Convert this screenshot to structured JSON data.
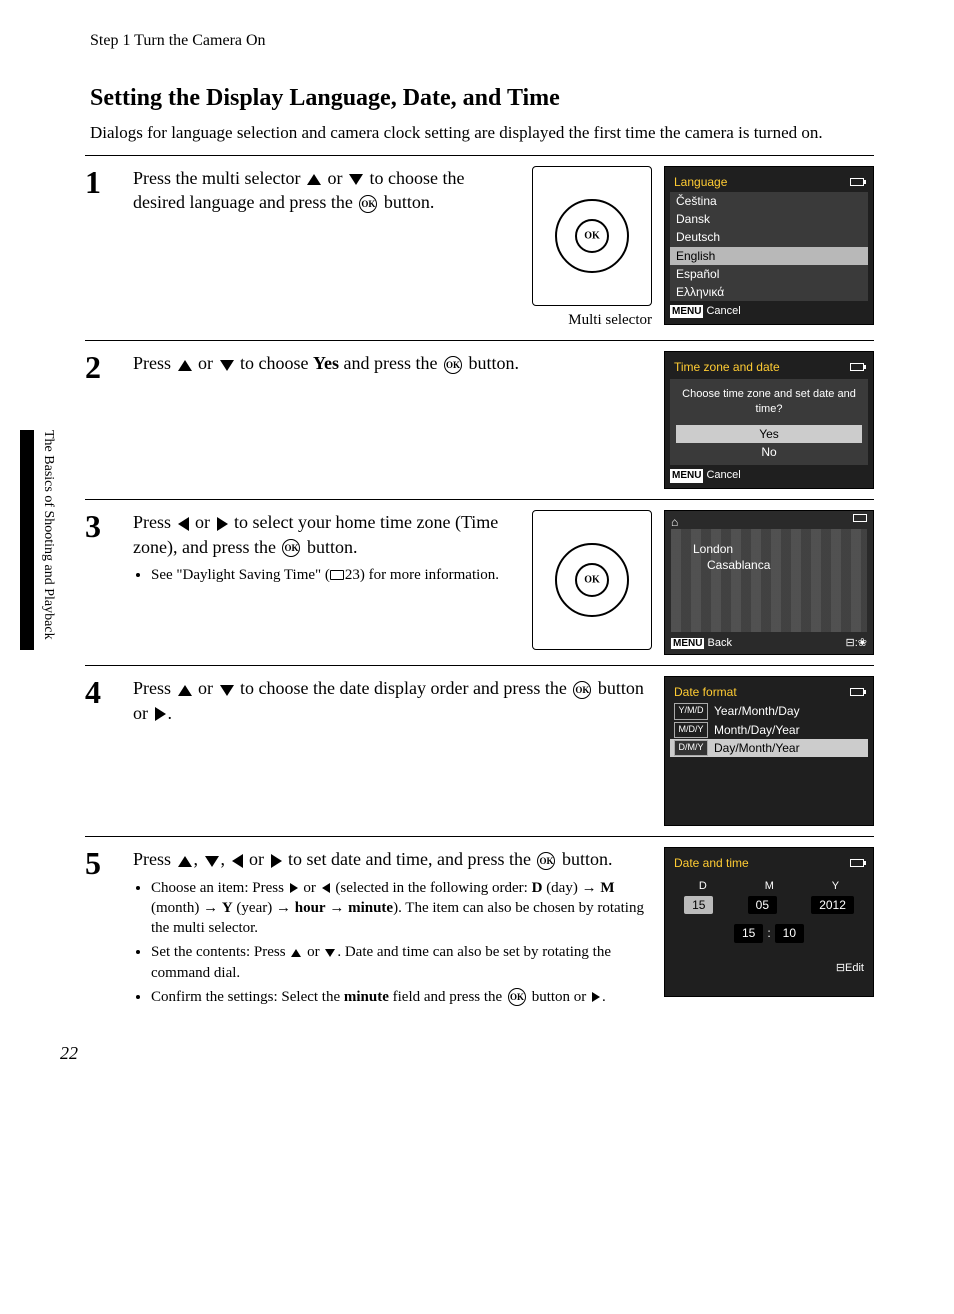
{
  "header_step": "Step 1 Turn the Camera On",
  "title": "Setting the Display Language, Date, and Time",
  "intro": "Dialogs for language selection and camera clock setting are displayed the first time the camera is turned on.",
  "side_tab": "The Basics of Shooting and Playback",
  "page_number": "22",
  "multi_selector_label": "Multi selector",
  "ok_label": "OK",
  "steps": {
    "s1": {
      "num": "1",
      "text_a": "Press the multi selector ",
      "text_b": " or ",
      "text_c": " to choose the desired language and press the ",
      "text_d": " button."
    },
    "s2": {
      "num": "2",
      "text_a": "Press ",
      "text_b": " or ",
      "text_c": " to choose ",
      "yes": "Yes",
      "text_d": " and press the ",
      "text_e": " button."
    },
    "s3": {
      "num": "3",
      "text_a": "Press ",
      "text_b": " or ",
      "text_c": " to select your home time zone (Time zone), and press the ",
      "text_d": " button.",
      "bullet_a": "See \"Daylight Saving Time\" (",
      "bullet_ref": "23",
      "bullet_b": ") for more information."
    },
    "s4": {
      "num": "4",
      "text_a": "Press ",
      "text_b": " or ",
      "text_c": " to choose the date display order and press the ",
      "text_d": " button or ",
      "text_e": "."
    },
    "s5": {
      "num": "5",
      "text_a": "Press ",
      "text_csv": ", ",
      "text_or": " or ",
      "text_b": " to set date and time, and press the ",
      "text_c": " button.",
      "b1_a": "Choose an item: Press ",
      "b1_b": " or ",
      "b1_c": " (selected in the following order: ",
      "b1_d": " (day) → ",
      "b1_m": " (month) → ",
      "b1_y": " (year) → ",
      "b1_hour": "hour",
      "b1_arrow": " → ",
      "b1_min": "minute",
      "b1_e": "). The item can also be chosen by rotating the multi selector.",
      "D": "D",
      "M": "M",
      "Y": "Y",
      "b2_a": "Set the contents: Press ",
      "b2_b": " or ",
      "b2_c": ". Date and time can also be set by rotating the command dial.",
      "b3_a": "Confirm the settings: Select the ",
      "b3_min": "minute",
      "b3_b": " field and press the ",
      "b3_c": " button or ",
      "b3_d": "."
    }
  },
  "lcd_lang": {
    "title": "Language",
    "items": [
      "Čeština",
      "Dansk",
      "Deutsch",
      "English",
      "Español",
      "Ελληνικά"
    ],
    "selected_index": 3,
    "cancel": "Cancel",
    "menu": "MENU"
  },
  "lcd_tz": {
    "title": "Time zone and date",
    "prompt": "Choose time zone and set date and time?",
    "yes": "Yes",
    "no": "No",
    "cancel": "Cancel",
    "menu": "MENU"
  },
  "lcd_map": {
    "city1": "London",
    "city2": "Casablanca",
    "back": "Back",
    "menu": "MENU"
  },
  "lcd_fmt": {
    "title": "Date format",
    "rows": [
      {
        "abbr": "Y/M/D",
        "label": "Year/Month/Day"
      },
      {
        "abbr": "M/D/Y",
        "label": "Month/Day/Year"
      },
      {
        "abbr": "D/M/Y",
        "label": "Day/Month/Year"
      }
    ],
    "selected_index": 2
  },
  "lcd_dt": {
    "title": "Date and time",
    "labels": {
      "d": "D",
      "m": "M",
      "y": "Y"
    },
    "values": {
      "d": "15",
      "m": "05",
      "y": "2012",
      "hh": "15",
      "mm": "10"
    },
    "edit": "Edit"
  }
}
